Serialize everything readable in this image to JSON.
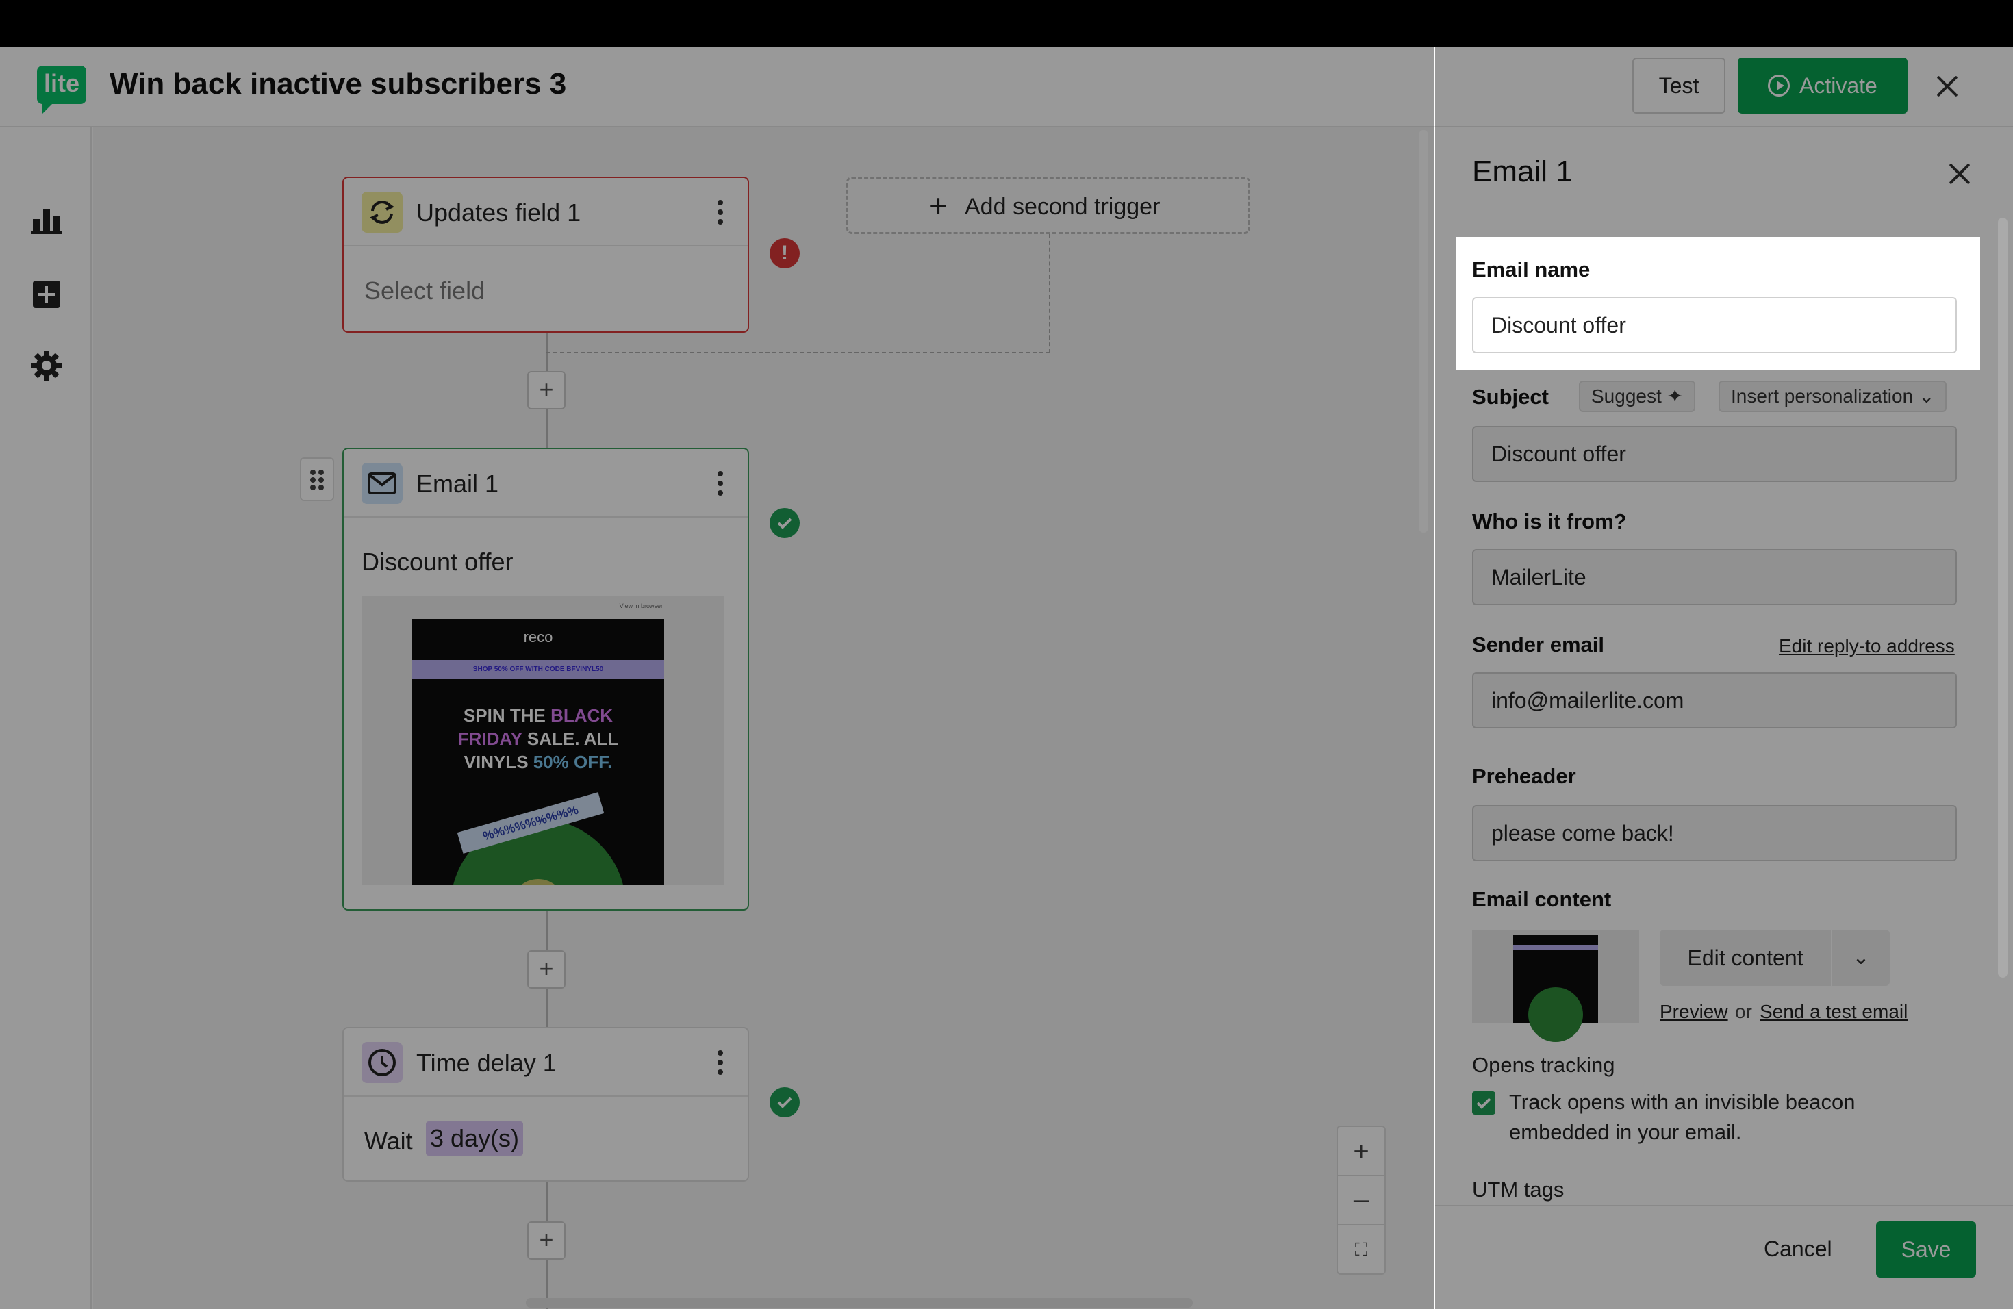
{
  "header": {
    "logo": "lite",
    "title": "Win back inactive subscribers 3",
    "test_label": "Test",
    "activate_label": "Activate"
  },
  "sidebar": {
    "items": [
      {
        "icon": "chart-icon"
      },
      {
        "icon": "add-square-icon"
      },
      {
        "icon": "gear-icon"
      }
    ]
  },
  "canvas": {
    "trigger": {
      "title": "Updates field 1",
      "body": "Select field",
      "status": "error"
    },
    "add_trigger_label": "Add second trigger",
    "email": {
      "title": "Email 1",
      "subject": "Discount offer",
      "status": "ok",
      "preview": {
        "brand": "reco",
        "promo_bar": "SHOP 50% OFF WITH CODE BFVINYL50",
        "top_link": "View in browser",
        "headline_1": "SPIN THE ",
        "headline_black": "BLACK",
        "headline_2": "FRIDAY",
        "headline_3": " SALE. ALL",
        "headline_4": "VINYLS ",
        "headline_50": "50% OFF.",
        "tape_text": "%%%%%%%%%"
      }
    },
    "delay": {
      "title": "Time delay 1",
      "wait_label": "Wait",
      "wait_value": "3 day(s)",
      "status": "ok"
    },
    "plus": "+"
  },
  "panel": {
    "title": "Email 1",
    "email_name_label": "Email name",
    "email_name_value": "Discount offer",
    "subject_label": "Subject",
    "suggest_label": "Suggest",
    "insert_personalization_label": "Insert personalization",
    "subject_value": "Discount offer",
    "from_label": "Who is it from?",
    "from_value": "MailerLite",
    "sender_email_label": "Sender email",
    "edit_reply_to_label": "Edit reply-to address",
    "sender_email_value": "info@mailerlite.com",
    "preheader_label": "Preheader",
    "preheader_value": "please come back!",
    "email_content_label": "Email content",
    "edit_content_label": "Edit content",
    "preview_link": "Preview",
    "or_text": "or",
    "send_test_link": "Send a test email",
    "opens_tracking_label": "Opens tracking",
    "track_opens_text": "Track opens with an invisible beacon embedded in your email.",
    "track_opens_checked": true,
    "utm_label": "UTM tags",
    "cancel_label": "Cancel",
    "save_label": "Save"
  },
  "colors": {
    "brand_green": "#09a250",
    "error_red": "#d93838",
    "ok_green": "#1f9d55",
    "trigger_icon_bg": "#f3eea0",
    "email_icon_bg": "#cfe4fa",
    "delay_icon_bg": "#e5d6f7"
  }
}
